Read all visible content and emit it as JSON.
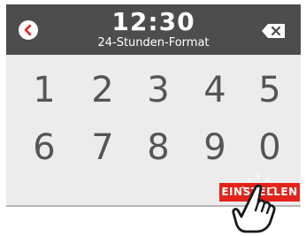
{
  "header": {
    "time": "12:30",
    "subtitle": "24-Stunden-Format",
    "back_icon": "chevron-left-icon",
    "delete_icon": "backspace-icon"
  },
  "keypad": {
    "keys": [
      "1",
      "2",
      "3",
      "4",
      "5",
      "6",
      "7",
      "8",
      "9",
      "0"
    ]
  },
  "confirm_label": "EINSTELLEN",
  "gesture_icon": "tap-hand-icon",
  "colors": {
    "header_bg": "#4d4d4d",
    "screen_bg": "#ececed",
    "accent": "#e2231a",
    "digit": "#555557"
  }
}
